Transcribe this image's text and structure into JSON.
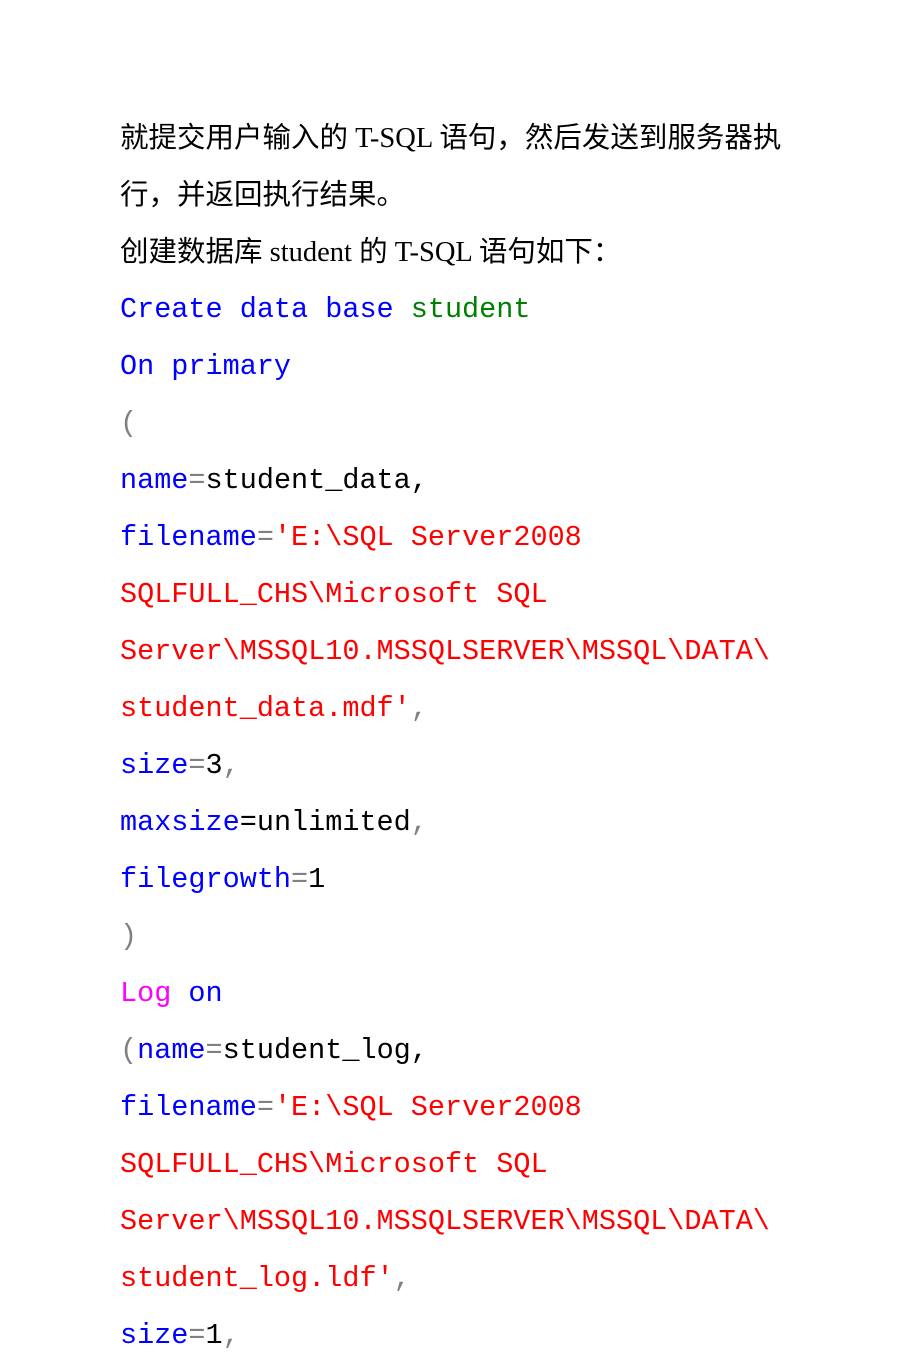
{
  "p1": "就提交用户输入的 T-SQL 语句，然后发送到服务器执",
  "p2": "行，并返回执行结果。",
  "p3": "创建数据库 student 的 T-SQL 语句如下：",
  "c1a": "Create data base ",
  "c1b": "student",
  "c2": "On primary",
  "c3": "(",
  "c4a": "name",
  "c4b": "=",
  "c4c": "student_data,",
  "c5a": "filename",
  "c5b": "=",
  "c5c": "'E:\\SQL Server2008 ",
  "c6": "SQLFULL_CHS\\Microsoft SQL ",
  "c7": "Server\\MSSQL10.MSSQLSERVER\\MSSQL\\DATA\\",
  "c8": "student_data.mdf'",
  "c8comma": ",",
  "c9a": "size",
  "c9b": "=",
  "c9c": "3",
  "c9d": ",",
  "c10a": "maxsize",
  "c10b": "=unlimited",
  "c10c": ",",
  "c11a": "filegrowth",
  "c11b": "=",
  "c11c": "1",
  "c12": ")",
  "c13a": "Log",
  "c13b": " on",
  "c14a": "(",
  "c14b": "name",
  "c14c": "=",
  "c14d": "student_log,",
  "c15a": "filename",
  "c15b": "=",
  "c15c": "'E:\\SQL Server2008 ",
  "c16": "SQLFULL_CHS\\Microsoft SQL ",
  "c17": "Server\\MSSQL10.MSSQLSERVER\\MSSQL\\DATA\\",
  "c18": "student_log.ldf'",
  "c18comma": ",",
  "c19a": "size",
  "c19b": "=",
  "c19c": "1",
  "c19d": ","
}
